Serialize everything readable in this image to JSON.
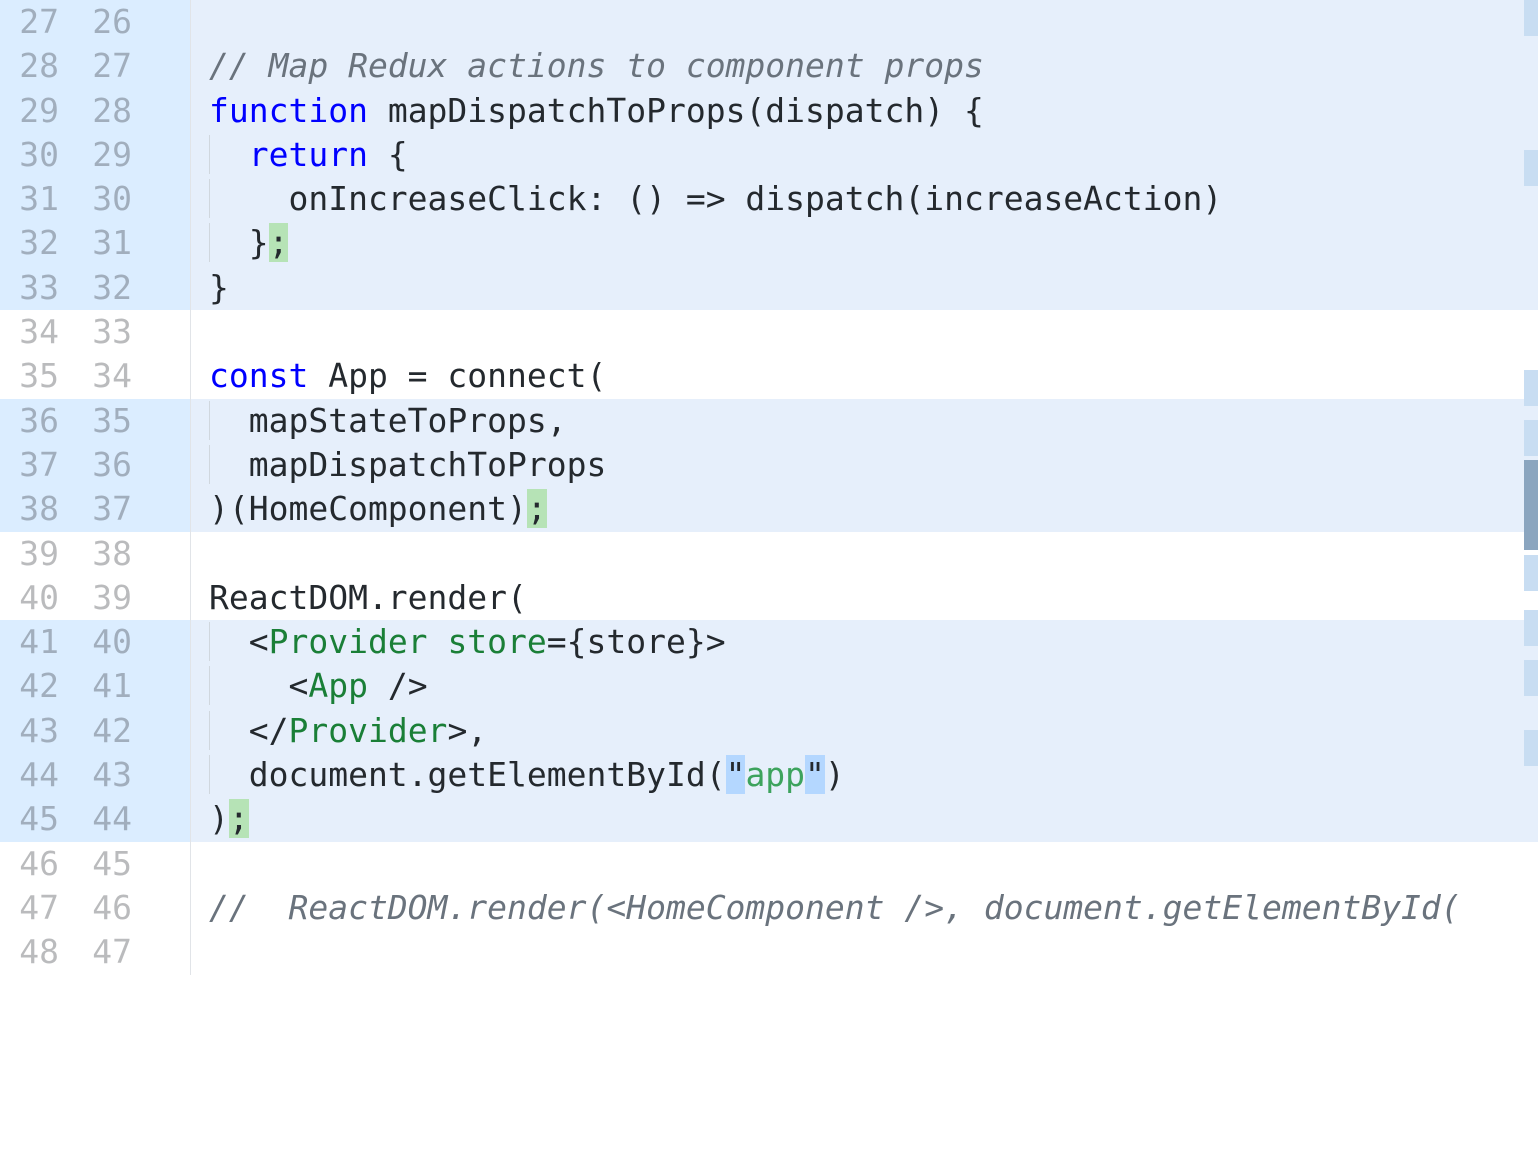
{
  "rows": [
    {
      "oldNum": "27",
      "newNum": "26",
      "hl": true,
      "tokens": [
        {
          "t": "",
          "cls": "tk-plain"
        }
      ],
      "guide": false
    },
    {
      "oldNum": "28",
      "newNum": "27",
      "hl": true,
      "tokens": [
        {
          "t": "// Map Redux actions to component props",
          "cls": "tk-comment"
        }
      ],
      "guide": false
    },
    {
      "oldNum": "29",
      "newNum": "28",
      "hl": true,
      "tokens": [
        {
          "t": "function",
          "cls": "tk-keyword"
        },
        {
          "t": " mapDispatchToProps(dispatch) {",
          "cls": "tk-plain"
        }
      ],
      "guide": false
    },
    {
      "oldNum": "30",
      "newNum": "29",
      "hl": true,
      "tokens": [
        {
          "t": "  ",
          "cls": "tk-plain"
        },
        {
          "t": "return",
          "cls": "tk-keyword"
        },
        {
          "t": " {",
          "cls": "tk-plain"
        }
      ],
      "guide": true
    },
    {
      "oldNum": "31",
      "newNum": "30",
      "hl": true,
      "tokens": [
        {
          "t": "    onIncreaseClick: () => dispatch(increaseAction)",
          "cls": "tk-plain"
        }
      ],
      "guide": true
    },
    {
      "oldNum": "32",
      "newNum": "31",
      "hl": true,
      "tokens": [
        {
          "t": "  }",
          "cls": "tk-plain"
        },
        {
          "t": ";",
          "cls": "tk-added"
        }
      ],
      "guide": true
    },
    {
      "oldNum": "33",
      "newNum": "32",
      "hl": true,
      "tokens": [
        {
          "t": "}",
          "cls": "tk-plain"
        }
      ],
      "guide": false
    },
    {
      "oldNum": "34",
      "newNum": "33",
      "hl": false,
      "tokens": [
        {
          "t": "",
          "cls": "tk-plain"
        }
      ],
      "guide": false
    },
    {
      "oldNum": "35",
      "newNum": "34",
      "hl": false,
      "tokens": [
        {
          "t": "const",
          "cls": "tk-keyword"
        },
        {
          "t": " App = connect(",
          "cls": "tk-plain"
        }
      ],
      "guide": false
    },
    {
      "oldNum": "36",
      "newNum": "35",
      "hl": true,
      "tokens": [
        {
          "t": "  mapStateToProps,",
          "cls": "tk-plain"
        }
      ],
      "guide": true
    },
    {
      "oldNum": "37",
      "newNum": "36",
      "hl": true,
      "tokens": [
        {
          "t": "  mapDispatchToProps",
          "cls": "tk-plain"
        }
      ],
      "guide": true
    },
    {
      "oldNum": "38",
      "newNum": "37",
      "hl": true,
      "tokens": [
        {
          "t": ")(HomeComponent)",
          "cls": "tk-plain"
        },
        {
          "t": ";",
          "cls": "tk-added"
        }
      ],
      "guide": false
    },
    {
      "oldNum": "39",
      "newNum": "38",
      "hl": false,
      "tokens": [
        {
          "t": "",
          "cls": "tk-plain"
        }
      ],
      "guide": false
    },
    {
      "oldNum": "40",
      "newNum": "39",
      "hl": false,
      "tokens": [
        {
          "t": "ReactDOM.render(",
          "cls": "tk-plain"
        }
      ],
      "guide": false
    },
    {
      "oldNum": "41",
      "newNum": "40",
      "hl": true,
      "tokens": [
        {
          "t": "  <",
          "cls": "tk-plain"
        },
        {
          "t": "Provider",
          "cls": "tk-tag"
        },
        {
          "t": " ",
          "cls": "tk-plain"
        },
        {
          "t": "store",
          "cls": "tk-attr"
        },
        {
          "t": "={store}>",
          "cls": "tk-plain"
        }
      ],
      "guide": true
    },
    {
      "oldNum": "42",
      "newNum": "41",
      "hl": true,
      "tokens": [
        {
          "t": "    <",
          "cls": "tk-plain"
        },
        {
          "t": "App",
          "cls": "tk-tag"
        },
        {
          "t": " />",
          "cls": "tk-plain"
        }
      ],
      "guide": true
    },
    {
      "oldNum": "43",
      "newNum": "42",
      "hl": true,
      "tokens": [
        {
          "t": "  </",
          "cls": "tk-plain"
        },
        {
          "t": "Provider",
          "cls": "tk-tag"
        },
        {
          "t": ">,",
          "cls": "tk-plain"
        }
      ],
      "guide": true
    },
    {
      "oldNum": "44",
      "newNum": "43",
      "hl": true,
      "tokens": [
        {
          "t": "  document.getElementById(",
          "cls": "tk-plain"
        },
        {
          "t": "\"",
          "cls": "tk-word-hl"
        },
        {
          "t": "app",
          "cls": "tk-string"
        },
        {
          "t": "\"",
          "cls": "tk-word-hl"
        },
        {
          "t": ")",
          "cls": "tk-plain"
        }
      ],
      "guide": true
    },
    {
      "oldNum": "45",
      "newNum": "44",
      "hl": true,
      "tokens": [
        {
          "t": ")",
          "cls": "tk-plain"
        },
        {
          "t": ";",
          "cls": "tk-added"
        }
      ],
      "guide": false
    },
    {
      "oldNum": "46",
      "newNum": "45",
      "hl": false,
      "tokens": [
        {
          "t": "",
          "cls": "tk-plain"
        }
      ],
      "guide": false
    },
    {
      "oldNum": "47",
      "newNum": "46",
      "hl": false,
      "tokens": [
        {
          "t": "//  ReactDOM.render(<HomeComponent />, document.getElementById(",
          "cls": "tk-comment"
        }
      ],
      "guide": false
    },
    {
      "oldNum": "48",
      "newNum": "47",
      "hl": false,
      "tokens": [
        {
          "t": "",
          "cls": "tk-plain"
        }
      ],
      "guide": false
    }
  ],
  "minimap": {
    "marks": [
      0,
      150,
      370,
      420,
      555,
      610,
      660,
      730
    ],
    "thumbTop": 460,
    "thumbHeight": 90
  }
}
